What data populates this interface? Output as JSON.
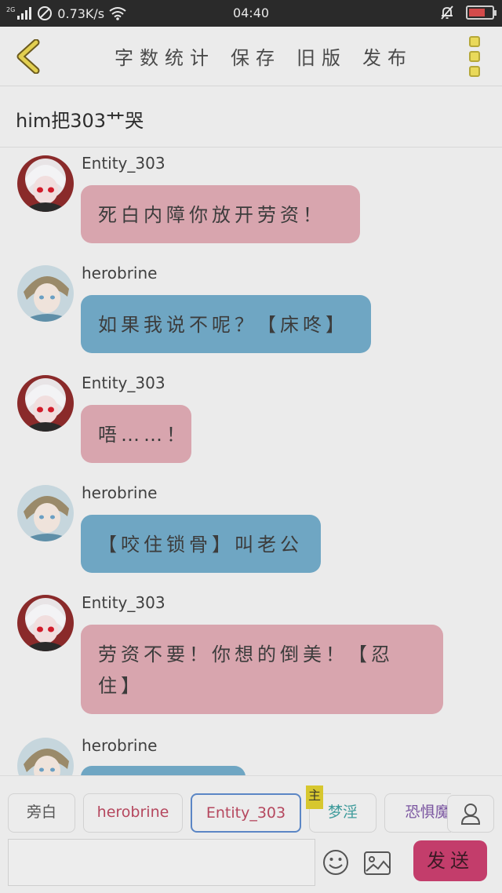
{
  "status_bar": {
    "network_tag": "2G",
    "speed": "0.73K/s",
    "time": "04:40",
    "battery_level_percent": 72
  },
  "toolbar": {
    "actions": [
      "字数统计",
      "保存",
      "旧版",
      "发布"
    ]
  },
  "story_title": "him把303艹哭",
  "messages": [
    {
      "sender": "Entity_303",
      "text": "死白内障你放开劳资！",
      "color": "pink",
      "avatar": "entity-avatar"
    },
    {
      "sender": "herobrine",
      "text": "如果我说不呢？【床咚】",
      "color": "blue",
      "avatar": "herobrine-avatar"
    },
    {
      "sender": "Entity_303",
      "text": "唔……！",
      "color": "pink",
      "avatar": "entity-avatar"
    },
    {
      "sender": "herobrine",
      "text": "【咬住锁骨】叫老公",
      "color": "blue",
      "avatar": "herobrine-avatar"
    },
    {
      "sender": "Entity_303",
      "text": "劳资不要！你想的倒美！【忍住】",
      "color": "pink",
      "avatar": "entity-avatar"
    },
    {
      "sender": "herobrine",
      "text": "",
      "color": "blue",
      "avatar": "herobrine-avatar"
    }
  ],
  "roles": [
    {
      "label": "旁白",
      "color": "#555555"
    },
    {
      "label": "herobrine",
      "color": "#b5475e"
    },
    {
      "label": "Entity_303",
      "color": "#b5475e"
    },
    {
      "label": "梦淫",
      "color": "#3e9b9b"
    },
    {
      "label": "恐惧魔",
      "color": "#7a55a0"
    }
  ],
  "role_badge": "主",
  "input": {
    "value": ""
  },
  "send_label": "发送",
  "colors": {
    "pink_bubble": "#d8a5ae",
    "blue_bubble": "#6fa6c3",
    "send_button": "#c33d6b",
    "active_role_border": "#5b86c5"
  }
}
